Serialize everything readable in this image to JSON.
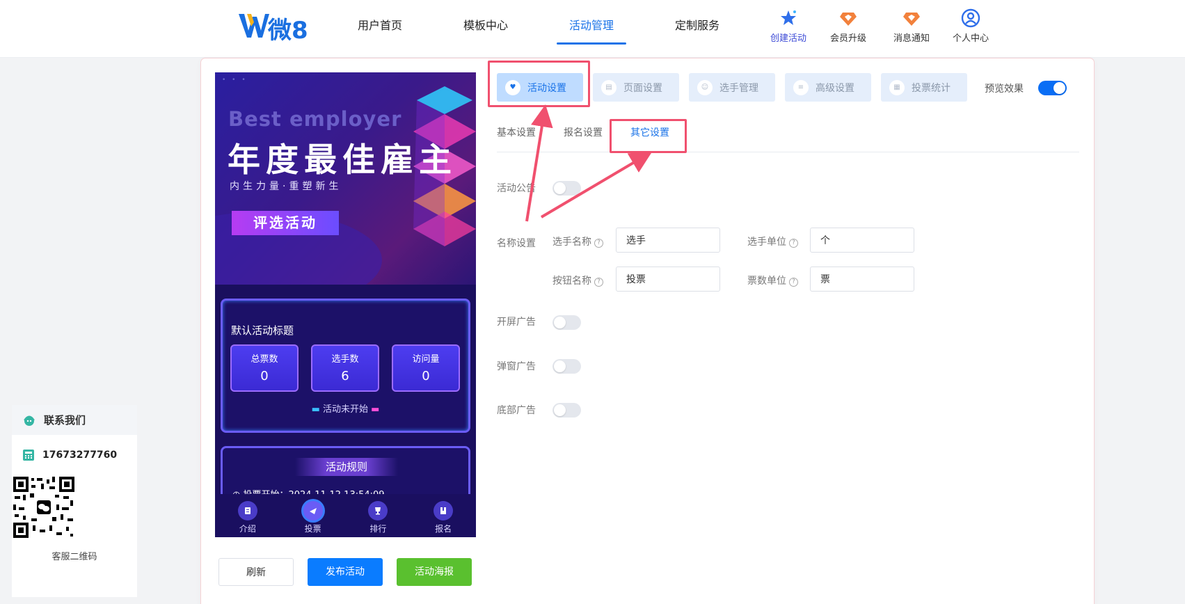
{
  "brand": {
    "logo_text": "微8"
  },
  "nav": [
    {
      "label": "用户首页"
    },
    {
      "label": "模板中心"
    },
    {
      "label": "活动管理"
    },
    {
      "label": "定制服务"
    }
  ],
  "header_icons": [
    {
      "label": "创建活动",
      "icon": "star-icon"
    },
    {
      "label": "会员升级",
      "icon": "diamond-icon"
    },
    {
      "label": "消息通知",
      "icon": "bell-icon"
    },
    {
      "label": "个人中心",
      "icon": "user-icon"
    }
  ],
  "preview": {
    "banner": {
      "dots": "• • •",
      "en_title": "Best employer",
      "title": "年度最佳雇主",
      "slogan": "内生力量·重塑新生",
      "tag": "评选活动"
    },
    "stats": {
      "title": "默认活动标题",
      "items": [
        {
          "label": "总票数",
          "value": "0"
        },
        {
          "label": "选手数",
          "value": "6"
        },
        {
          "label": "访问量",
          "value": "0"
        }
      ],
      "status": "活动未开始"
    },
    "rules": {
      "title": "活动规则",
      "start_line": "投票开始：2024-11-12 13:54:09"
    },
    "tabbar": [
      {
        "label": "介绍"
      },
      {
        "label": "投票"
      },
      {
        "label": "排行"
      },
      {
        "label": "报名"
      }
    ]
  },
  "actions": {
    "refresh": "刷新",
    "publish": "发布活动",
    "poster": "活动海报"
  },
  "settings_tabs": [
    {
      "label": "活动设置",
      "active": true
    },
    {
      "label": "页面设置"
    },
    {
      "label": "选手管理"
    },
    {
      "label": "高级设置"
    },
    {
      "label": "投票统计"
    }
  ],
  "preview_toggle": {
    "label": "预览效果",
    "on": true
  },
  "sub_tabs": [
    {
      "label": "基本设置"
    },
    {
      "label": "报名设置"
    },
    {
      "label": "其它设置",
      "active": true
    }
  ],
  "form": {
    "notice_label": "活动公告",
    "name_settings_label": "名称设置",
    "contestant_name_label": "选手名称",
    "contestant_name_value": "选手",
    "contestant_unit_label": "选手单位",
    "contestant_unit_value": "个",
    "button_name_label": "按钮名称",
    "button_name_value": "投票",
    "vote_unit_label": "票数单位",
    "vote_unit_value": "票",
    "splash_ad_label": "开屏广告",
    "popup_ad_label": "弹窗广告",
    "bottom_ad_label": "底部广告"
  },
  "contact": {
    "title": "联系我们",
    "phone": "17673277760",
    "qr_label": "客服二维码"
  },
  "colors": {
    "primary": "#0a7cff",
    "accent_green": "#5ac02f",
    "annotation_red": "#f0506e"
  }
}
